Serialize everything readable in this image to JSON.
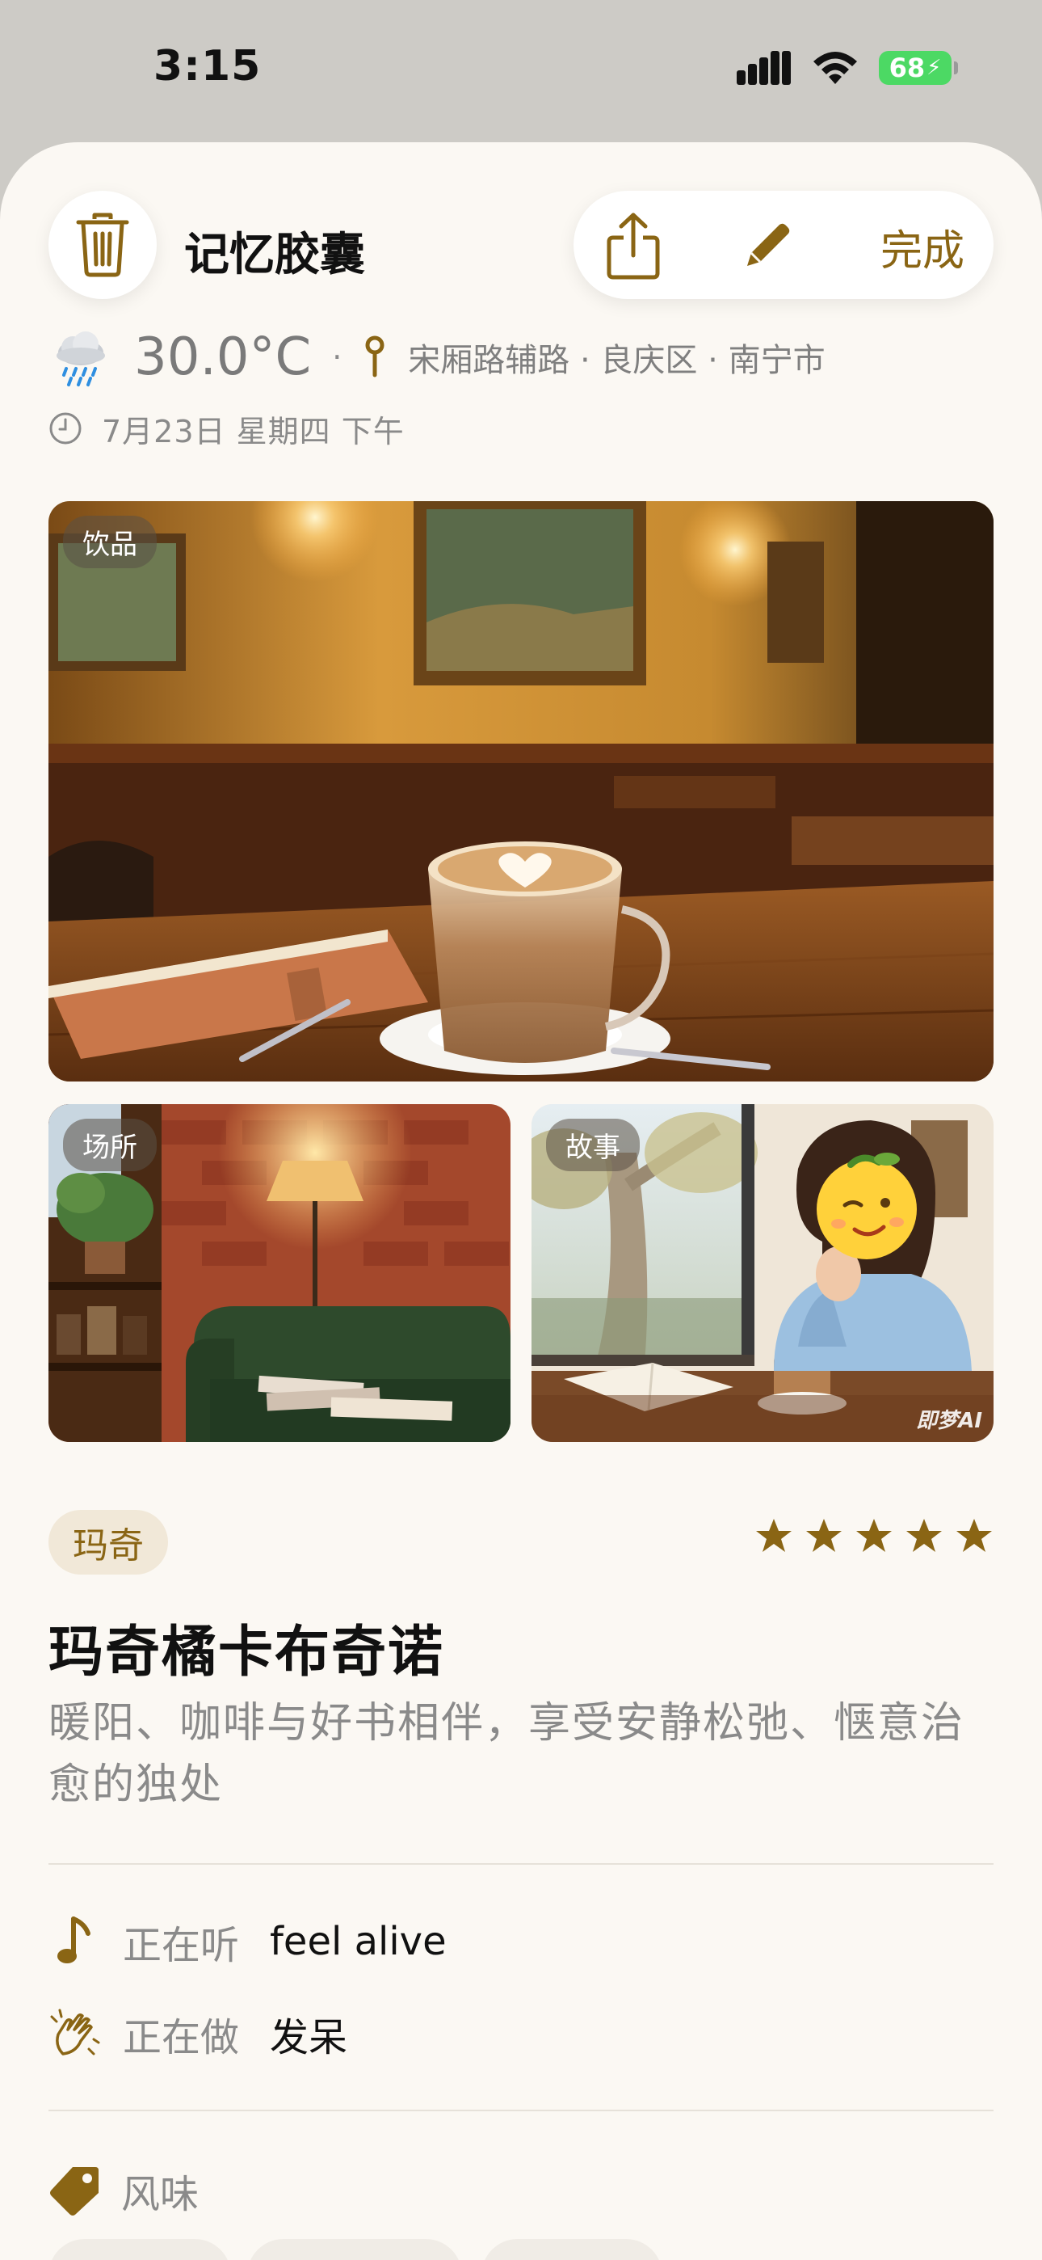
{
  "status_bar": {
    "time": "3:15",
    "battery": "68"
  },
  "top_bar": {
    "title": "记忆胶囊",
    "done_label": "完成"
  },
  "meta": {
    "temperature": "30.0°C",
    "separator": "·",
    "location": "宋厢路辅路 · 良庆区 · 南宁市",
    "date": "7月23日 星期四  下午"
  },
  "photos": [
    {
      "tag": "饮品"
    },
    {
      "tag": "场所"
    },
    {
      "tag": "故事",
      "watermark": "即梦AI"
    }
  ],
  "drink": {
    "brand": "玛奇",
    "rating": 5,
    "name": "玛奇橘卡布奇诺",
    "description": "暖阳、咖啡与好书相伴，享受安静松弛、惬意治愈的独处"
  },
  "activities": {
    "listening_label": "正在听",
    "listening_value": "feel alive",
    "doing_label": "正在做",
    "doing_value": "发呆"
  },
  "flavor": {
    "label": "风味"
  },
  "colors": {
    "accent": "#8a6514",
    "background": "#fbf8f3",
    "battery": "#4cd964"
  },
  "icons": [
    "trash-icon",
    "share-icon",
    "pencil-icon",
    "cloud-rain-icon",
    "pin-icon",
    "clock-icon",
    "star-icon",
    "music-note-icon",
    "clapping-hands-icon",
    "tag-icon"
  ]
}
